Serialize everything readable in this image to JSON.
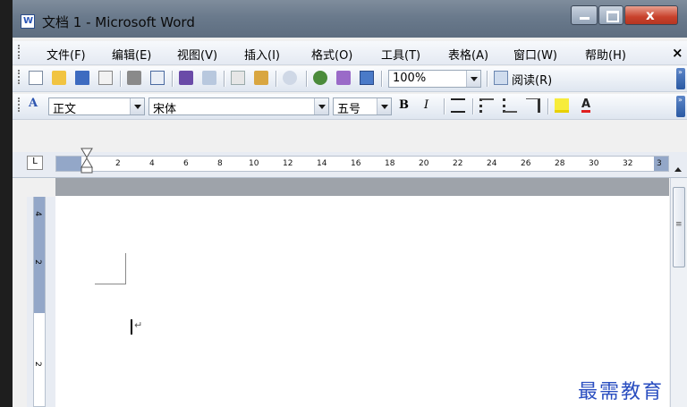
{
  "window": {
    "title": "文档 1 - Microsoft Word"
  },
  "menu": {
    "items": [
      "文件(F)",
      "编辑(E)",
      "视图(V)",
      "插入(I)",
      "格式(O)",
      "工具(T)",
      "表格(A)",
      "窗口(W)",
      "帮助(H)"
    ],
    "close_label": "×"
  },
  "standard_toolbar": {
    "zoom": "100%",
    "reading_label": "阅读(R)"
  },
  "formatting_toolbar": {
    "style": "正文",
    "font": "宋体",
    "size": "五号",
    "bold": "B",
    "italic": "I",
    "font_color_label": "A"
  },
  "ruler": {
    "horizontal": [
      "2",
      "4",
      "6",
      "8",
      "10",
      "12",
      "14",
      "16",
      "18",
      "20",
      "22",
      "24",
      "26",
      "28",
      "30",
      "32",
      "3"
    ],
    "vertical": [
      "4",
      "2",
      "2"
    ]
  },
  "watermark": "最需教育",
  "colors": {
    "title_bar": "#6a7a8c",
    "close_button": "#c8412c",
    "ruler_margin": "#93a7c8",
    "watermark": "#2a4ec0"
  }
}
